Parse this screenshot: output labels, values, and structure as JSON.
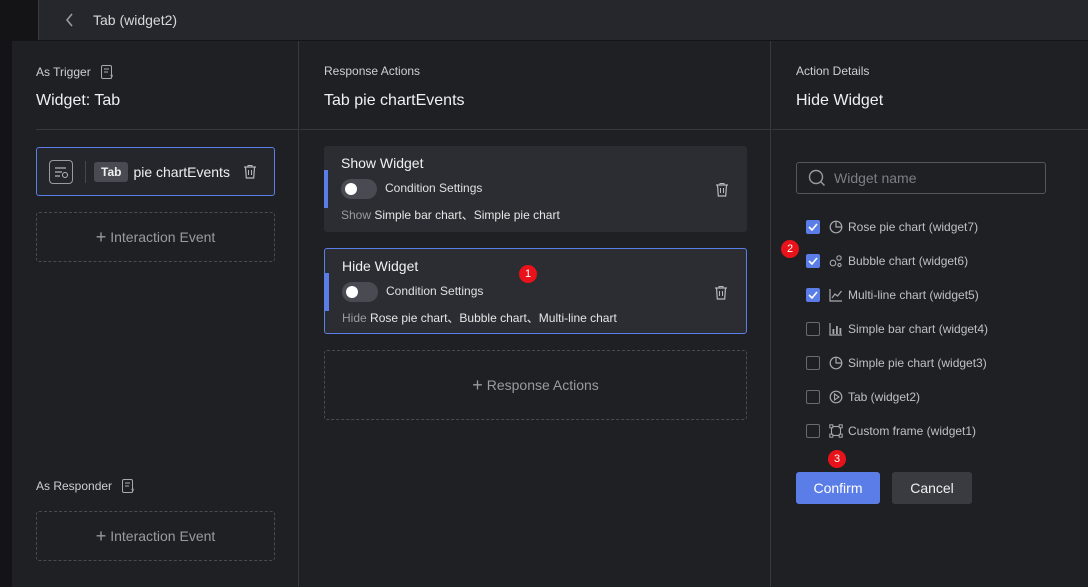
{
  "topbar": {
    "title": "Tab (widget2)",
    "back_icon": "chevron-left-icon"
  },
  "trigger": {
    "section_label": "As Trigger",
    "title": "Widget: Tab",
    "event": {
      "badge": "Tab",
      "name": "pie chartEvents"
    },
    "add_label": "Interaction Event"
  },
  "responder": {
    "section_label": "As Responder",
    "add_label": "Interaction Event"
  },
  "responses": {
    "section_label": "Response Actions",
    "title": "Tab pie chartEvents",
    "actions": [
      {
        "title": "Show Widget",
        "condition_label": "Condition Settings",
        "verb": "Show",
        "targets": "Simple bar chart、Simple pie chart"
      },
      {
        "title": "Hide Widget",
        "condition_label": "Condition Settings",
        "verb": "Hide",
        "targets": "Rose pie chart、Bubble chart、Multi-line chart"
      }
    ],
    "add_label": "Response Actions"
  },
  "details": {
    "section_label": "Action Details",
    "title": "Hide Widget",
    "search_placeholder": "Widget name",
    "widgets": [
      {
        "label": "Rose pie chart (widget7)",
        "checked": true,
        "icon": "pie-chart-icon"
      },
      {
        "label": "Bubble chart (widget6)",
        "checked": true,
        "icon": "bubble-chart-icon"
      },
      {
        "label": "Multi-line chart (widget5)",
        "checked": true,
        "icon": "line-chart-icon"
      },
      {
        "label": "Simple bar chart (widget4)",
        "checked": false,
        "icon": "bar-chart-icon"
      },
      {
        "label": "Simple pie chart (widget3)",
        "checked": false,
        "icon": "pie-chart-icon"
      },
      {
        "label": "Tab (widget2)",
        "checked": false,
        "icon": "tab-icon"
      },
      {
        "label": "Custom frame (widget1)",
        "checked": false,
        "icon": "frame-icon"
      }
    ],
    "confirm_label": "Confirm",
    "cancel_label": "Cancel"
  },
  "markers": [
    "1",
    "2",
    "3"
  ],
  "colors": {
    "accent": "#5b7de8",
    "marker": "#e8121a",
    "background": "#1f2024"
  }
}
